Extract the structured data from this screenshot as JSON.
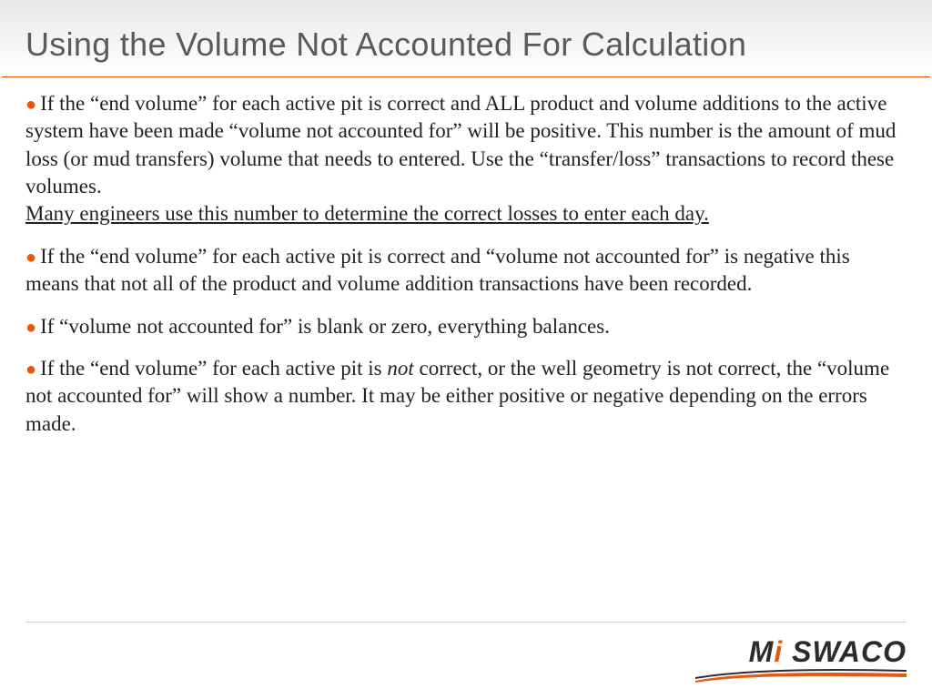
{
  "slide": {
    "title": "Using the Volume Not Accounted For Calculation",
    "bullets": [
      {
        "main": "If the “end volume” for each active pit is correct and ALL product and volume additions to the active system have been made “volume not accounted for” will be positive.  This number is the amount of mud loss (or mud transfers) volume that needs to entered.  Use the “transfer/loss” transactions to record these volumes.",
        "underlined": "Many engineers use this number to determine the correct losses to enter each day."
      },
      {
        "main": "If the “end volume” for each active pit is correct and “volume not accounted for” is negative this means that not all of the product and volume addition transactions have been recorded."
      },
      {
        "main": "If “volume not accounted for”  is blank or zero, everything balances."
      },
      {
        "pre": "If the “end volume” for each active pit is ",
        "italic": "not",
        "post": " correct, or the well geometry is not correct, the “volume not accounted for” will show a number.  It may be either positive or negative depending on the errors made."
      }
    ]
  },
  "branding": {
    "logo_m": "M",
    "logo_i": "i",
    "logo_rest": " SWACO"
  }
}
